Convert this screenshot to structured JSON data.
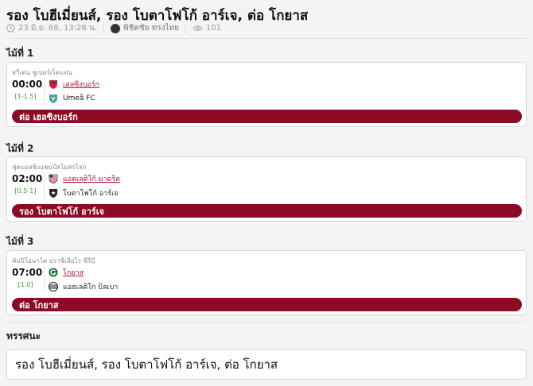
{
  "article": {
    "title": "รอง โบฮีเมี่ยนส์, รอง โบตาโฟโก้ อาร์เจ, ต่อ โกยาส",
    "date": "23 มิ.ย. 68, 13:28 น.",
    "author": "พิชิตชัย ทรงไทย",
    "views": "101"
  },
  "matches": [
    {
      "label": "ไม้ที่ 1",
      "league": "สวีเดน ซูเปอร์เร็ตแท่น",
      "time": "00:00",
      "handicap": "[1-1.5]",
      "home": "เฮลซิงบอร์ก",
      "away": "Umeå FC",
      "tip": "ต่อ เฮลซิงบอร์ก"
    },
    {
      "label": "ไม้ที่ 2",
      "league": "ฟุตบอลชิงแชมป์สโมสรโลก",
      "time": "02:00",
      "handicap": "[0.5-1]",
      "home": "แอตเลติโก้ มาดริด",
      "away": "โบตาโฟโก้ อาร์เจ",
      "tip": "รอง โบตาโฟโก้ อาร์เจ"
    },
    {
      "label": "ไม้ที่ 3",
      "league": "คัมปิโอนาโต บราซิเลียโร ซีรีบี",
      "time": "07:00",
      "handicap": "[1.0]",
      "home": "โกยาส",
      "away": "แอธเลติโก บิลเบา",
      "tip": "ต่อ โกยาส"
    }
  ],
  "verdict": {
    "label": "ทรรศนะ",
    "text": "รอง โบฮีเมี่ยนส์, รอง โบตาโฟโก้ อาร์เจ, ต่อ โกยาส"
  },
  "colors": {
    "tip_bar": "#8c0a24",
    "favorite_link": "#b5122f",
    "handicap_text": "#3a9a3a"
  },
  "icons": [
    "clock-icon",
    "avatar",
    "eye-icon",
    "helsingborg-logo",
    "umea-logo",
    "atletico-logo",
    "botafogo-logo",
    "goias-logo",
    "bilbao-logo"
  ]
}
